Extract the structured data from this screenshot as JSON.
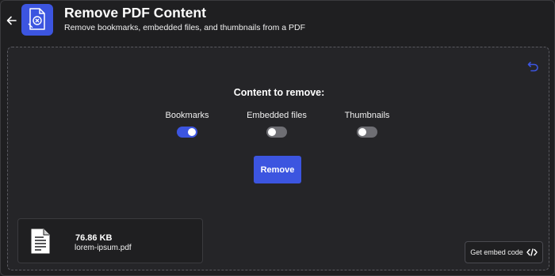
{
  "header": {
    "title": "Remove PDF Content",
    "subtitle": "Remove bookmarks, embedded files, and thumbnails from a PDF",
    "back_icon": "arrow-left-icon",
    "app_icon": "pdf-remove-icon"
  },
  "panel": {
    "undo_icon": "undo-icon",
    "heading": "Content to remove:",
    "options": [
      {
        "label": "Bookmarks",
        "enabled": true
      },
      {
        "label": "Embedded files",
        "enabled": false
      },
      {
        "label": "Thumbnails",
        "enabled": false
      }
    ],
    "remove_label": "Remove",
    "file": {
      "size": "76.86 KB",
      "name": "lorem-ipsum.pdf",
      "icon": "document-icon"
    },
    "embed_label": "Get embed code",
    "embed_icon": "code-icon"
  },
  "colors": {
    "accent": "#3c55e0",
    "background": "#1f1f21",
    "panel": "#252528",
    "toggle_off": "#6e6e73"
  }
}
